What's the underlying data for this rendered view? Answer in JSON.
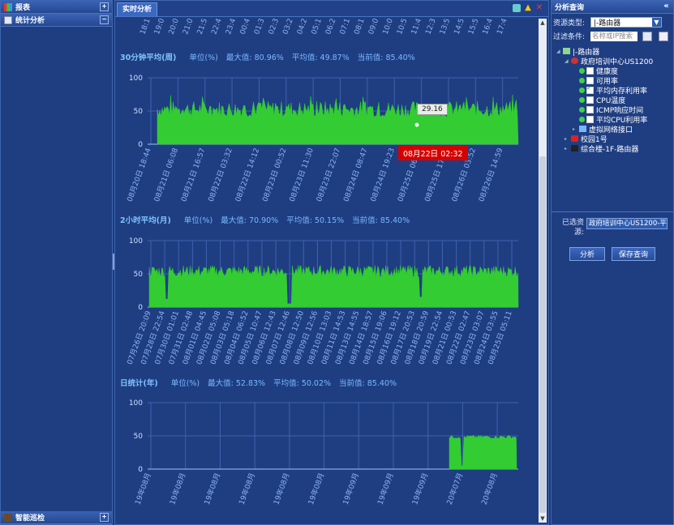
{
  "left": {
    "items": [
      {
        "label": "报表",
        "toggle": "+"
      },
      {
        "label": "统计分析",
        "toggle": "−"
      }
    ],
    "bottom": {
      "label": "智能巡检",
      "toggle": "+"
    }
  },
  "center": {
    "tab": "实时分析",
    "charts": [
      {
        "title": "30分钟平均(周)",
        "unit": "单位(%)",
        "max": "最大值: 80.96%",
        "avg": "平均值: 49.87%",
        "cur": "当前值: 85.40%",
        "ylim": [
          0,
          100
        ],
        "yticks": [
          "0",
          "50",
          "100"
        ],
        "xticks": [
          "08月20日 18:44",
          "08月21日 06:08",
          "08月21日 16:57",
          "08月22日 03:32",
          "08月22日 14:12",
          "08月23日 00:52",
          "08月23日 11:30",
          "08月23日 22:07",
          "08月24日 08:47",
          "08月24日 19:23",
          "08月25日 06:00",
          "08月25日 17:00",
          "08月26日 03:52",
          "08月26日 14:59"
        ],
        "tooltip_value": "29.16",
        "tooltip_time": "08月22日 02:32",
        "color": "#33cc33"
      },
      {
        "title": "2小时平均(月)",
        "unit": "单位(%)",
        "max": "最大值: 70.90%",
        "avg": "平均值: 50.15%",
        "cur": "当前值: 85.40%",
        "ylim": [
          0,
          100
        ],
        "yticks": [
          "0",
          "50",
          "100"
        ],
        "xticks": [
          "07月26日 20:09",
          "07月28日 22:54",
          "07月30日 01:01",
          "07月31日 02:48",
          "08月01日 04:45",
          "08月02日 05:08",
          "08月03日 05:18",
          "08月04日 06:52",
          "08月05日 10:47",
          "08月06日 12:43",
          "08月07日 12:46",
          "08月08日 12:50",
          "08月09日 12:56",
          "08月10日 13:03",
          "08月11日 14:53",
          "08月13日 14:55",
          "08月14日 18:57",
          "08月15日 19:06",
          "08月16日 19:12",
          "08月17日 20:53",
          "08月18日 20:59",
          "08月19日 22:54",
          "08月21日 00:53",
          "08月22日 02:47",
          "08月23日 03:07",
          "08月24日 03:55",
          "08月25日 05:11"
        ],
        "color": "#33cc33"
      },
      {
        "title": "日统计(年)",
        "unit": "单位(%)",
        "max": "最大值: 52.83%",
        "avg": "平均值: 50.02%",
        "cur": "当前值: 85.40%",
        "ylim": [
          0,
          100
        ],
        "yticks": [
          "0",
          "50",
          "100"
        ],
        "xticks": [
          "19年08月",
          "19年08月",
          "19年08月",
          "19年08月",
          "19年08月",
          "19年08月",
          "19年09月",
          "19年09月",
          "19年09月",
          "20年07月",
          "20年08月"
        ],
        "color": "#33cc33"
      }
    ],
    "top_ticks": [
      "18:1",
      "19:0",
      "20:0",
      "21:0",
      "21:5",
      "22:4",
      "23:4",
      "00:4",
      "01:3",
      "02:3",
      "03:2",
      "04:2",
      "05:1",
      "06:2",
      "07:1",
      "08:1",
      "09:0",
      "10:0",
      "10:5",
      "11:4",
      "12:3",
      "13:5",
      "14:5",
      "15:5",
      "16:4",
      "17:4"
    ]
  },
  "right": {
    "title": "分析查询",
    "collapse": "«",
    "resource_type_label": "资源类型:",
    "resource_type_value": "|-路由器",
    "filter_label": "过滤条件:",
    "filter_placeholder": "名称或IP搜索",
    "tree": [
      {
        "label": "|-路由器",
        "depth": 0,
        "kind": "root"
      },
      {
        "label": "政府培训中心US1200",
        "depth": 1,
        "kind": "device"
      },
      {
        "label": "健康度",
        "depth": 2,
        "kind": "metric",
        "checked": false
      },
      {
        "label": "可用率",
        "depth": 2,
        "kind": "metric",
        "checked": false
      },
      {
        "label": "平均内存利用率",
        "depth": 2,
        "kind": "metric",
        "checked": true
      },
      {
        "label": "CPU温度",
        "depth": 2,
        "kind": "metric",
        "checked": false
      },
      {
        "label": "ICMP响应时间",
        "depth": 2,
        "kind": "metric",
        "checked": false
      },
      {
        "label": "平均CPU利用率",
        "depth": 2,
        "kind": "metric",
        "checked": false
      },
      {
        "label": "虚拟网络接口",
        "depth": 2,
        "kind": "iface"
      },
      {
        "label": "校园1号",
        "depth": 1,
        "kind": "device2"
      },
      {
        "label": "综合楼-1F-路由器",
        "depth": 1,
        "kind": "device3"
      }
    ],
    "selected_label": "已选资源:",
    "selected_value": "政府培训中心US1200-平",
    "analyze_btn": "分析",
    "save_btn": "保存查询"
  }
}
